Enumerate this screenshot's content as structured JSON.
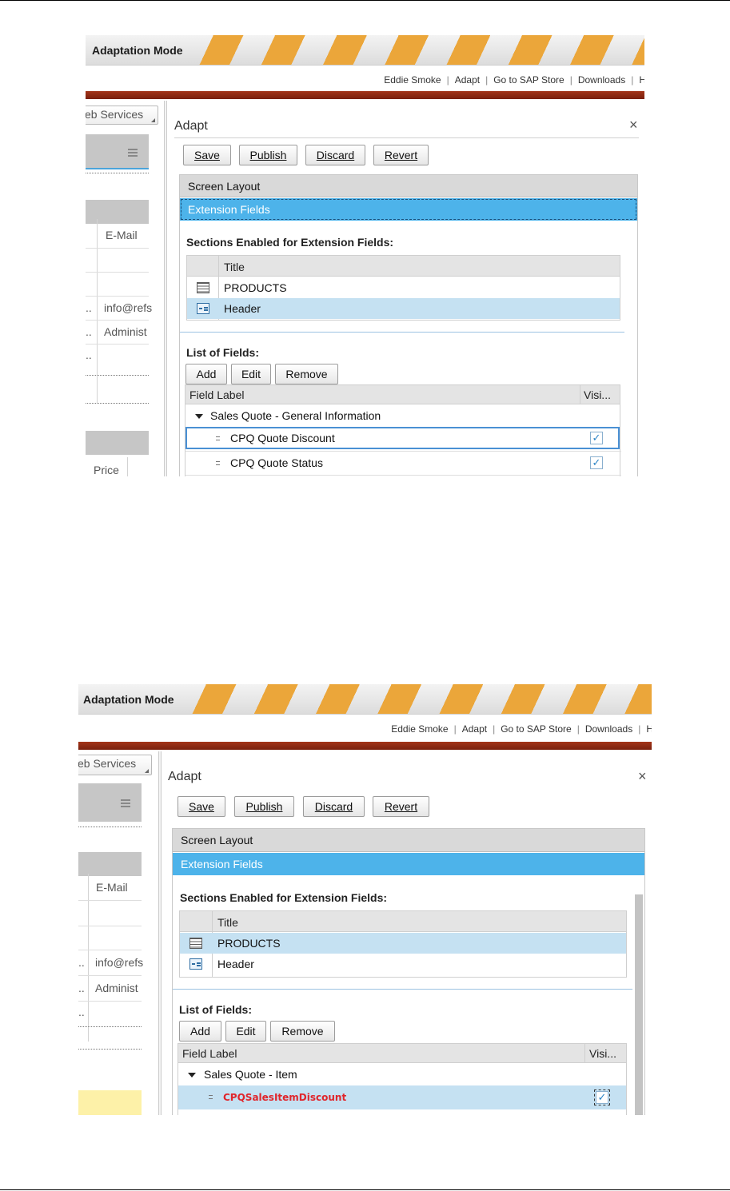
{
  "banner": {
    "title": "Adaptation Mode"
  },
  "toplinks": [
    "Eddie Smoke",
    "Adapt",
    "Go to SAP Store",
    "Downloads",
    "H"
  ],
  "left_app": {
    "dropdown_label": "eb Services",
    "email_header": "E-Mail",
    "row_values": [
      "info@refs",
      "Administ"
    ],
    "truncation": "..",
    "price_header": "Price"
  },
  "adapt": {
    "title": "Adapt",
    "close": "×",
    "buttons": {
      "save": "Save",
      "publish": "Publish",
      "discard": "Discard",
      "revert": "Revert"
    },
    "nav": {
      "screen_layout": "Screen Layout",
      "extension_fields": "Extension Fields"
    },
    "sections_heading": "Sections Enabled for Extension Fields:",
    "sections_col_title": "Title",
    "sections": [
      {
        "icon": "table-grid-icon",
        "title": "PRODUCTS"
      },
      {
        "icon": "form-layout-icon",
        "title": "Header"
      }
    ],
    "fields_heading": "List of Fields:",
    "field_buttons": {
      "add": "Add",
      "edit": "Edit",
      "remove": "Remove"
    },
    "fields_col_label": "Field Label",
    "fields_col_visible": "Visi...",
    "checkmark": "✓"
  },
  "screenshot1": {
    "group": "Sales Quote - General Information",
    "fields": [
      "CPQ Quote Discount",
      "CPQ Quote Status"
    ]
  },
  "screenshot2": {
    "group": "Sales Quote - Item",
    "fields": [
      "CPQSalesItemDiscount"
    ]
  }
}
